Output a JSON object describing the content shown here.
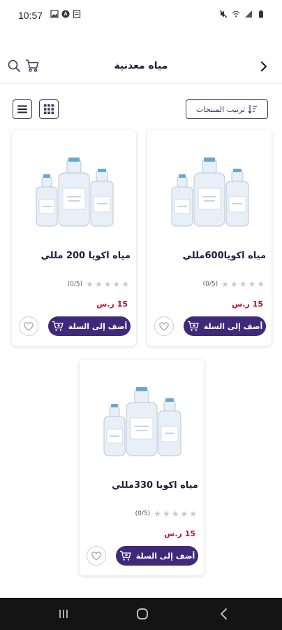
{
  "status_bar": {
    "time": "10:57",
    "icons": [
      "image-icon",
      "app-icon",
      "note-icon",
      "mute-icon",
      "wifi-icon",
      "signal-icon",
      "battery-icon"
    ]
  },
  "header": {
    "title": "مياه معدنية",
    "icons": [
      "back-arrow-icon",
      "search-icon",
      "cart-icon"
    ]
  },
  "toolbar": {
    "sort_label": "ترتيب المنتجات"
  },
  "products": [
    {
      "name": "مياه اكويا600مللي",
      "rating": 0,
      "rating_label": "(0/5)",
      "price": "15 ر.س",
      "add_label": "أضف إلى السلة"
    },
    {
      "name": "مياه اكويا 200 مللي",
      "rating": 0,
      "rating_label": "(0/5)",
      "price": "15 ر.س",
      "add_label": "أضف إلى السلة"
    },
    {
      "name": "مياه اكويا 330مللي",
      "rating": 0,
      "rating_label": "(0/5)",
      "price": "15 ر.س",
      "add_label": "أضف إلى السلة"
    }
  ],
  "colors": {
    "accent": "#3f2a7a",
    "price": "#c0122c",
    "title": "#1d1d3a"
  }
}
